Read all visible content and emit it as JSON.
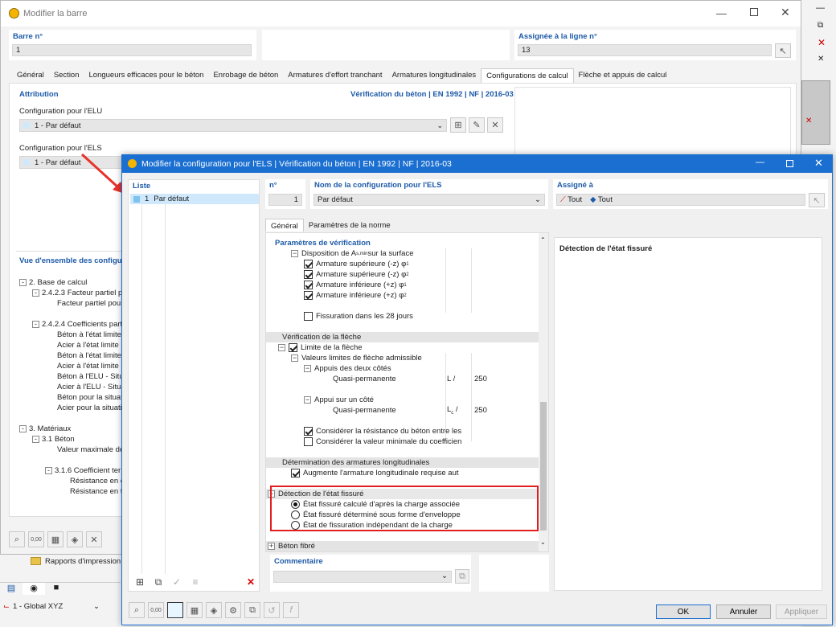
{
  "back": {
    "title": "Modifier la barre",
    "barre_label": "Barre n°",
    "barre_value": "1",
    "assignee_label": "Assignée à la ligne n°",
    "assignee_value": "13",
    "tabs": [
      "Général",
      "Section",
      "Longueurs efficaces pour le béton",
      "Enrobage de béton",
      "Armatures d'effort tranchant",
      "Armatures longitudinales",
      "Configurations de calcul",
      "Flèche et appuis de calcul"
    ],
    "active_tab": 6,
    "attribution": "Attribution",
    "verif": "Vérification du béton | EN 1992 | NF | 2016-03",
    "elu_label": "Configuration pour l'ELU",
    "elu_value": "1 - Par défaut",
    "els_label": "Configuration pour l'ELS",
    "els_value": "1 - Par défaut",
    "overview": "Vue d'ensemble des configura",
    "tree": [
      {
        "l": "2. Base de calcul",
        "d": 0,
        "e": "-"
      },
      {
        "l": "2.4.2.3 Facteur partiel p",
        "d": 1,
        "e": "-"
      },
      {
        "l": "Facteur partiel pour",
        "d": 2
      },
      {
        "l": "",
        "d": 2
      },
      {
        "l": "2.4.2.4 Coefficients parti",
        "d": 1,
        "e": "-"
      },
      {
        "l": "Béton à l'état limite",
        "d": 2
      },
      {
        "l": "Acier à l'état limite u",
        "d": 2
      },
      {
        "l": "Béton à l'état limite",
        "d": 2
      },
      {
        "l": "Acier à l'état limite u",
        "d": 2
      },
      {
        "l": "Béton à l'ELU - Situat",
        "d": 2
      },
      {
        "l": "Acier à l'ELU - Situat",
        "d": 2
      },
      {
        "l": "Béton pour la situati",
        "d": 2
      },
      {
        "l": "Acier pour la situati",
        "d": 2
      },
      {
        "l": "",
        "d": 2
      },
      {
        "l": "3. Matériaux",
        "d": 0,
        "e": "-"
      },
      {
        "l": "3.1 Béton",
        "d": 1,
        "e": "-"
      },
      {
        "l": "Valeur maximale de",
        "d": 2
      },
      {
        "l": "",
        "d": 2
      },
      {
        "l": "3.1.6 Coefficient ter",
        "d": 2,
        "e": "-"
      },
      {
        "l": "Résistance en co",
        "d": 3
      },
      {
        "l": "Résistance en tr",
        "d": 3
      }
    ],
    "print_reports": "Rapports d'impression",
    "view_label": "1 - Global XYZ"
  },
  "dialog": {
    "title": "Modifier la configuration pour l'ELS | Vérification du béton | EN 1992 | NF | 2016-03",
    "liste_label": "Liste",
    "list_item_num": "1",
    "list_item_label": "Par défaut",
    "n_label": "n°",
    "n_value": "1",
    "name_label": "Nom de la configuration pour l'ELS",
    "name_value": "Par défaut",
    "assigned_label": "Assigné à",
    "assigned_1": "Tout",
    "assigned_2": "Tout",
    "tabs": [
      "Général",
      "Paramètres de la norme"
    ],
    "params_title": "Paramètres de vérification",
    "disposition": "Disposition de A",
    "disposition_sub": "s,min",
    "disposition_rest": " sur la surface",
    "arm_items": [
      {
        "l": "Armature supérieure (-z) φ",
        "s": "1"
      },
      {
        "l": "Armature supérieure (-z) φ",
        "s": "2"
      },
      {
        "l": "Armature inférieure (+z) φ",
        "s": "1"
      },
      {
        "l": "Armature inférieure (+z) φ",
        "s": "2"
      }
    ],
    "fissuration": "Fissuration dans les 28 jours",
    "verif_fleche": "Vérification de la flèche",
    "limite_fleche": "Limite de la flèche",
    "valeurs_limites": "Valeurs limites de flèche admissible",
    "appuis_deux": "Appuis des deux côtés",
    "quasi1": "Quasi-permanente",
    "unit1": "L /",
    "val1": "250",
    "appui_un": "Appui sur un côté",
    "quasi2": "Quasi-permanente",
    "unit2": "L",
    "unit2_sub": "c",
    "unit2_after": " /",
    "val2": "250",
    "considerer1": "Considérer la résistance du béton entre les",
    "considerer2": "Considérer la valeur minimale du coefficien",
    "determination": "Détermination des armatures longitudinales",
    "augmente": "Augmente l'armature longitudinale requise aut",
    "detection_title": "Détection de l'état fissuré",
    "radios": [
      "État fissuré calculé d'après la charge associée",
      "État fissuré déterminé sous forme d'enveloppe",
      "État de fissuration indépendant de la charge"
    ],
    "radio_selected": 0,
    "beton_fibre": "Béton fibré",
    "info_title": "Détection de l'état fissuré",
    "commentaire": "Commentaire",
    "ok": "OK",
    "annuler": "Annuler",
    "appliquer": "Appliquer"
  },
  "colors": {
    "accent": "#1565c0",
    "title_bg": "#1b6fd1",
    "highlight": "#e02020",
    "arrow": "#e8322b",
    "selected_row": "#cfe8fb",
    "section_blue": "#1d5aa8"
  }
}
